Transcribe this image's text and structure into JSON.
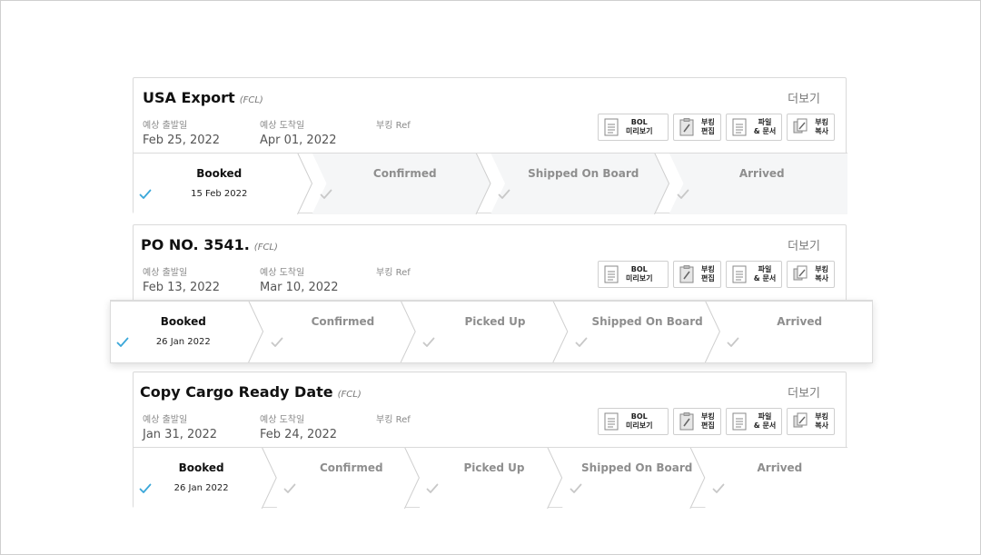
{
  "common": {
    "more_label": "더보기",
    "labels": {
      "departure": "예상 출발일",
      "arrival": "예상 도착일",
      "booking_ref": "부킹 Ref"
    },
    "buttons": [
      {
        "line1": "BOL",
        "line2": "미리보기",
        "icon": "document-icon"
      },
      {
        "line1": "부킹",
        "line2": "편집",
        "icon": "edit-clipboard-icon"
      },
      {
        "line1": "파일",
        "line2": "& 문서",
        "icon": "file-list-icon"
      },
      {
        "line1": "부킹",
        "line2": "복사",
        "icon": "copy-icon"
      }
    ],
    "colors": {
      "check_active": "#3aa7d9",
      "check_inactive": "#c8c8c8",
      "stage_bg_inactive": "#f5f6f7"
    }
  },
  "shipments": [
    {
      "title": "USA Export",
      "type": "(FCL)",
      "departure": "Feb 25, 2022",
      "arrival": "Apr 01, 2022",
      "booking_ref": "",
      "stages": [
        {
          "name": "Booked",
          "date": "15 Feb 2022",
          "active": true
        },
        {
          "name": "Confirmed",
          "active": false
        },
        {
          "name": "Shipped On Board",
          "active": false
        },
        {
          "name": "Arrived",
          "active": false
        }
      ]
    },
    {
      "title": "PO NO. 3541.",
      "type": "(FCL)",
      "departure": "Feb 13, 2022",
      "arrival": "Mar 10, 2022",
      "booking_ref": "",
      "stages": [
        {
          "name": "Booked",
          "date": "26 Jan 2022",
          "active": true
        },
        {
          "name": "Confirmed",
          "active": false
        },
        {
          "name": "Picked Up",
          "active": false
        },
        {
          "name": "Shipped On Board",
          "active": false
        },
        {
          "name": "Arrived",
          "active": false
        }
      ]
    },
    {
      "title": "Copy Cargo Ready Date",
      "type": "(FCL)",
      "departure": "Jan 31, 2022",
      "arrival": "Feb 24, 2022",
      "booking_ref": "",
      "stages": [
        {
          "name": "Booked",
          "date": "26 Jan 2022",
          "active": true
        },
        {
          "name": "Confirmed",
          "active": false
        },
        {
          "name": "Picked Up",
          "active": false
        },
        {
          "name": "Shipped On Board",
          "active": false
        },
        {
          "name": "Arrived",
          "active": false
        }
      ]
    }
  ]
}
